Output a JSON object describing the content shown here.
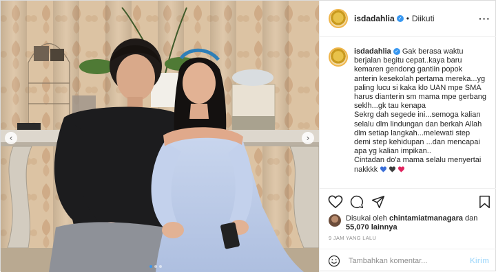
{
  "post": {
    "username": "isdadahlia",
    "follow_status": "Diikuti",
    "follow_separator": "•",
    "more_icon": "more-options-icon",
    "verified_icon": "verified-badge-icon"
  },
  "caption": {
    "username": "isdadahlia",
    "text": "Gak berasa waktu berjalan begitu cepat..kaya baru kemaren gendong gantiin popok anterin kesekolah pertama mereka...yg paling lucu si kaka klo UAN mpe SMA harus dianterin sm mama mpe gerbang seklh...gk tau kenapa\nSekrg dah segede ini...semoga kalian selalu dlm lindungan dan berkah Allah dlm setiap langkah...melewati step demi step kehidupan ...dan mencapai apa yg kalian impikan..\nCintadan do'a mama selalu menyertai nakkkk",
    "hearts": [
      "#3b6fd8",
      "#3d3d3d",
      "#e0245e"
    ]
  },
  "actions": {
    "like_icon": "heart-icon",
    "comment_icon": "comment-icon",
    "share_icon": "share-icon",
    "save_icon": "bookmark-icon"
  },
  "likes": {
    "prefix": "Disukai oleh",
    "liker": "chintamiatmanagara",
    "conjunction": "dan",
    "count": "55,070 lainnya"
  },
  "timestamp": "9 JAM YANG LALU",
  "comment_box": {
    "placeholder": "Tambahkan komentar...",
    "send_label": "Kirim",
    "emoji_icon": "emoji-icon"
  },
  "carousel": {
    "prev_glyph": "‹",
    "next_glyph": "›",
    "slide_count": 3,
    "active_slide": 1
  },
  "colors": {
    "accent": "#3897f0",
    "send_disabled": "#b2dffc",
    "muted": "#8e8e8e"
  }
}
